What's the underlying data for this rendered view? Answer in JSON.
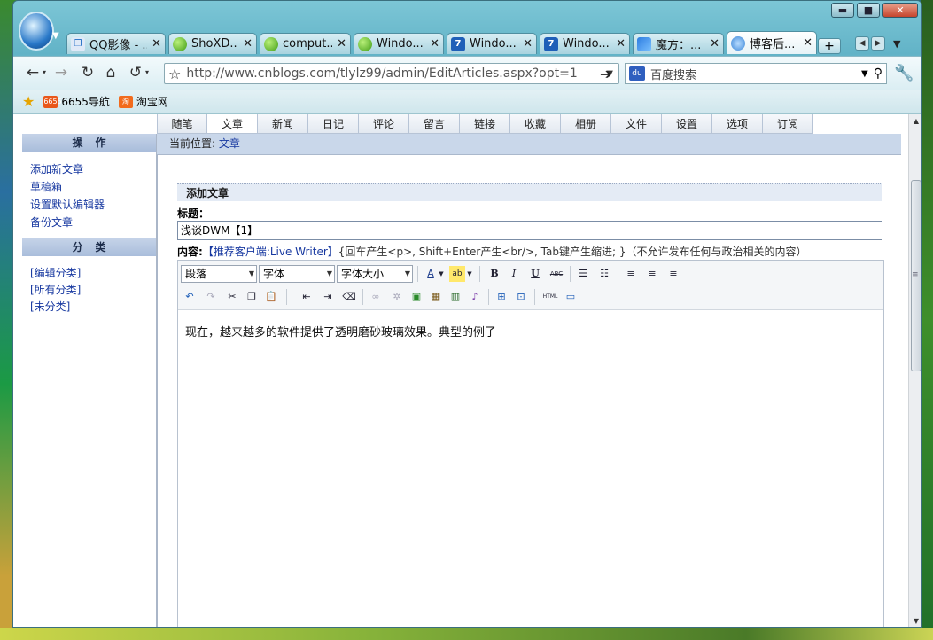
{
  "window": {
    "controls": {
      "minimize": "▬",
      "maximize": "■",
      "close": "✕"
    }
  },
  "tabs": [
    {
      "label": "QQ影像 - ...",
      "icon": "qq-icon",
      "close": "✕"
    },
    {
      "label": "ShoXD...",
      "icon": "green-ball-icon",
      "close": "✕"
    },
    {
      "label": "comput...",
      "icon": "green-ball-icon",
      "close": "✕"
    },
    {
      "label": "Windo...",
      "icon": "green-ball-icon",
      "close": "✕"
    },
    {
      "label": "Windo...",
      "icon": "blue-7-icon",
      "close": "✕"
    },
    {
      "label": "Windo...",
      "icon": "blue-7-icon",
      "close": "✕"
    },
    {
      "label": "魔方：...",
      "icon": "cube-icon",
      "close": "✕"
    },
    {
      "label": "博客后...",
      "icon": "cnblogs-icon",
      "close": "✕",
      "active": true
    }
  ],
  "new_tab_label": "+",
  "navbar": {
    "url": "http://www.cnblogs.com/tlylz99/admin/EditArticles.aspx?opt=1",
    "search_placeholder": "百度搜索"
  },
  "bookmarks": [
    {
      "label": "6655导航",
      "icon_text": "6655"
    },
    {
      "label": "淘宝网",
      "icon_text": "淘"
    }
  ],
  "topnav": [
    "随笔",
    "文章",
    "新闻",
    "日记",
    "评论",
    "留言",
    "链接",
    "收藏",
    "相册",
    "文件",
    "设置",
    "选项",
    "订阅"
  ],
  "topnav_active": "文章",
  "sidebar": {
    "ops_header": "操作",
    "ops": [
      "添加新文章",
      "草稿箱",
      "设置默认编辑器",
      "备份文章"
    ],
    "cat_header": "分类",
    "cats": [
      "[编辑分类]",
      "[所有分类]",
      "[未分类]"
    ]
  },
  "breadcrumb": {
    "prefix": "当前位置: ",
    "link": "文章"
  },
  "form": {
    "section_title": "添加文章",
    "title_label": "标题：",
    "title_value": "浅谈DWM【1】",
    "content_label": "内容:",
    "client_link": "【推荐客户端:Live Writer】",
    "hint": "{回车产生<p>, Shift+Enter产生<br/>, Tab键产生缩进; }（不允许发布任何与政治相关的内容）"
  },
  "editor": {
    "format_select": "段落",
    "font_select": "字体",
    "size_select": "字体大小",
    "bold": "B",
    "italic": "I",
    "underline": "U",
    "strike": "ABC",
    "html": "HTML",
    "body_text": "现在，越来越多的软件提供了透明磨砂玻璃效果。典型的例子"
  }
}
